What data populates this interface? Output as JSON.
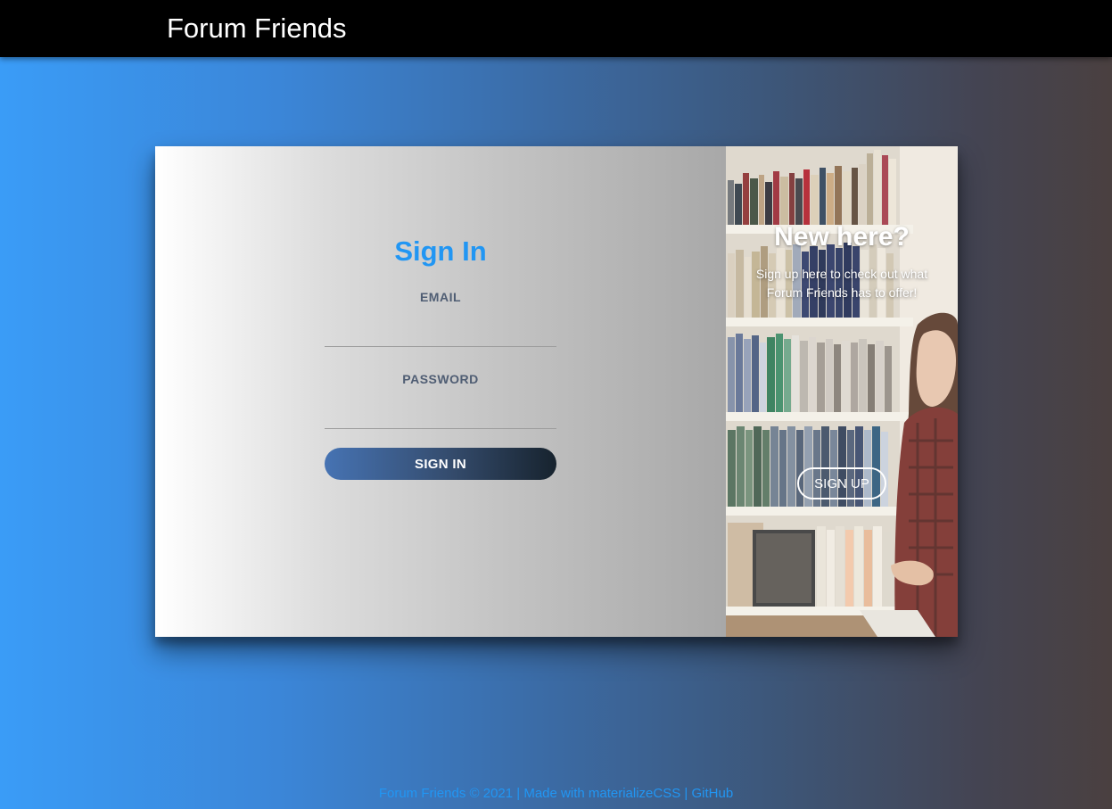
{
  "navbar": {
    "brand": "Forum Friends"
  },
  "signin": {
    "title": "Sign In",
    "email_label": "EMAIL",
    "email_value": "",
    "password_label": "PASSWORD",
    "password_value": "",
    "button_label": "SIGN IN"
  },
  "signup": {
    "title": "New here?",
    "text": "Sign up here to check out what Forum Friends has to offer!",
    "button_label": "SIGN UP"
  },
  "footer": {
    "copyright": "Forum Friends © 2021",
    "separator_1": "|",
    "made_with": "Made with materializeCSS",
    "separator_2": "|",
    "github": "GitHub"
  },
  "colors": {
    "navbar": "#000000",
    "accent": "#2196f3",
    "label": "#4f5d73"
  },
  "icons": {
    "signup_background": "bookshelf-photo"
  }
}
